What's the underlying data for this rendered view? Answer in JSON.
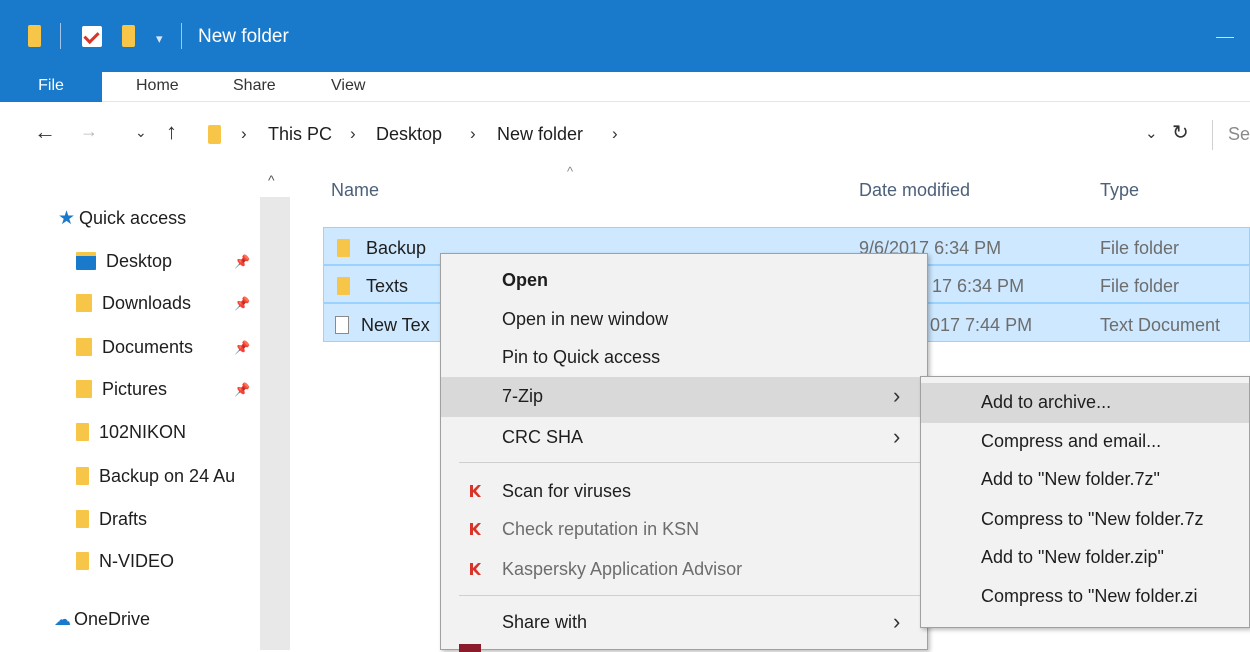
{
  "window": {
    "title": "New folder"
  },
  "ribbon": {
    "tabs": [
      "File",
      "Home",
      "Share",
      "View"
    ]
  },
  "address": {
    "crumbs": [
      "This PC",
      "Desktop",
      "New folder"
    ],
    "search_placeholder": "Se"
  },
  "nav_pane": {
    "quick_access": "Quick access",
    "items": [
      {
        "label": "Desktop",
        "pinned": true
      },
      {
        "label": "Downloads",
        "pinned": true
      },
      {
        "label": "Documents",
        "pinned": true
      },
      {
        "label": "Pictures",
        "pinned": true
      },
      {
        "label": "102NIKON",
        "pinned": false
      },
      {
        "label": "Backup on 24 Au",
        "pinned": false
      },
      {
        "label": "Drafts",
        "pinned": false
      },
      {
        "label": "N-VIDEO",
        "pinned": false
      }
    ],
    "onedrive": "OneDrive"
  },
  "file_list": {
    "columns": [
      "Name",
      "Date modified",
      "Type"
    ],
    "rows": [
      {
        "name": "Backup",
        "date": "9/6/2017 6:34 PM",
        "type": "File folder"
      },
      {
        "name": "Texts",
        "date": "17 6:34 PM",
        "type": "File folder"
      },
      {
        "name": "New Tex",
        "date": "017 7:44 PM",
        "type": "Text Document"
      }
    ]
  },
  "context_menu": {
    "items": [
      "Open",
      "Open in new window",
      "Pin to Quick access",
      "7-Zip",
      "CRC SHA",
      "Scan for viruses",
      "Check reputation in KSN",
      "Kaspersky Application Advisor",
      "Share with"
    ]
  },
  "submenu_7zip": {
    "items": [
      "Add to archive...",
      "Compress and email...",
      "Add to \"New folder.7z\"",
      "Compress to \"New folder.7z",
      "Add to \"New folder.zip\"",
      "Compress to \"New folder.zi"
    ]
  },
  "colors": {
    "titlebar": "#1979ca",
    "selection": "#cde8ff",
    "menu_bg": "#f2f2f2",
    "menu_highlight": "#d9d9d9",
    "folder": "#f7c548",
    "kaspersky": "#d8352a"
  }
}
